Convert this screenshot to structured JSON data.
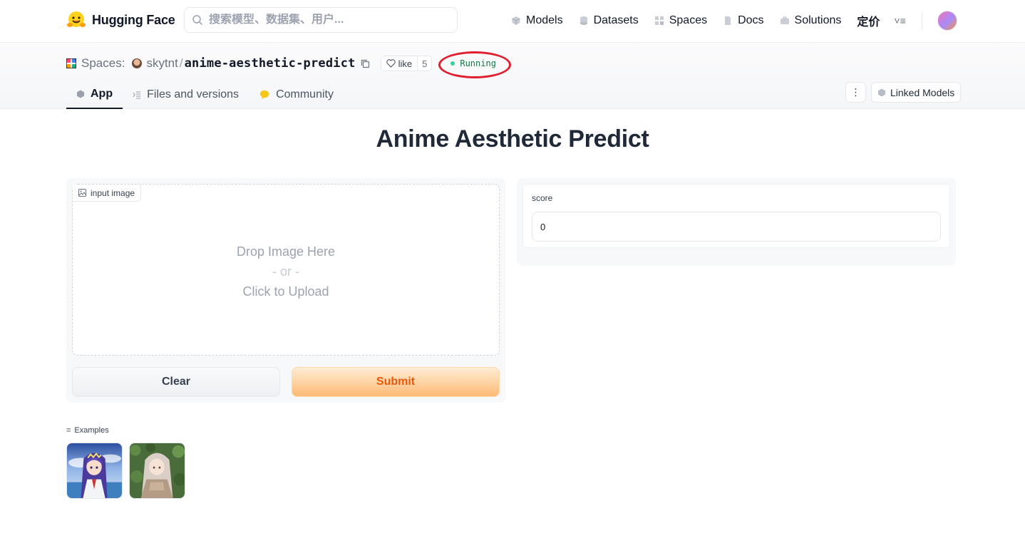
{
  "topnav": {
    "brand_name": "Hugging Face",
    "search_placeholder": "搜索模型、数据集、用户...",
    "links": [
      {
        "label": "Models",
        "icon": "cube-icon"
      },
      {
        "label": "Datasets",
        "icon": "database-icon"
      },
      {
        "label": "Spaces",
        "icon": "grid-icon"
      },
      {
        "label": "Docs",
        "icon": "doc-icon"
      },
      {
        "label": "Solutions",
        "icon": "briefcase-icon"
      }
    ],
    "pricing_label": "定价",
    "more_icon": "menu-icon"
  },
  "space": {
    "section_label": "Spaces:",
    "owner": "skytnt",
    "separator": "/",
    "repo_name": "anime-aesthetic-predict",
    "like_label": "like",
    "like_count": "5",
    "status": "Running",
    "status_color": "#16774a",
    "highlight_color": "#e11d2e"
  },
  "tabs": [
    {
      "label": "App",
      "active": true
    },
    {
      "label": "Files and versions",
      "active": false
    },
    {
      "label": "Community",
      "active": false
    }
  ],
  "header_actions": {
    "linked_models_label": "Linked Models"
  },
  "app": {
    "title": "Anime Aesthetic Predict",
    "input_label": "input image",
    "drop_text": "Drop Image Here",
    "or_text": "- or -",
    "upload_text": "Click to Upload",
    "clear_label": "Clear",
    "submit_label": "Submit",
    "submit_color": "#ea580c",
    "output_label": "score",
    "output_value": "0",
    "examples_label": "Examples"
  }
}
